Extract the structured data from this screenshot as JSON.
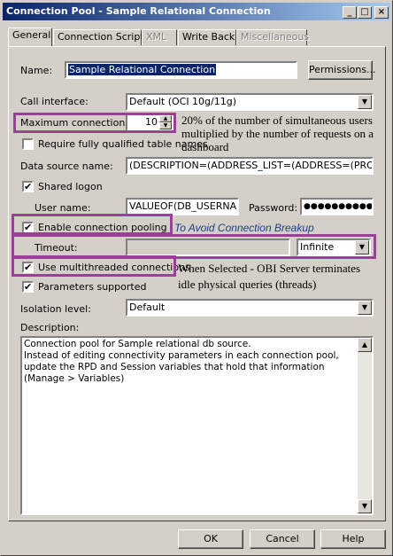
{
  "window": {
    "title": "Connection Pool - Sample Relational Connection",
    "minimize": "_",
    "maximize": "□",
    "close": "×"
  },
  "tabs": [
    {
      "label": "General",
      "active": true
    },
    {
      "label": "Connection Scripts"
    },
    {
      "label": "XML",
      "disabled": true
    },
    {
      "label": "Write Back"
    },
    {
      "label": "Miscellaneous",
      "disabled": true
    }
  ],
  "form": {
    "name_label": "Name:",
    "name_value": "Sample Relational Connection",
    "permissions_button": "Permissions...",
    "call_interface_label": "Call interface:",
    "call_interface_value": "Default (OCI 10g/11g)",
    "max_connections_label": "Maximum connections:",
    "max_connections_value": "10",
    "require_qualified_label": "Require fully qualified table names",
    "require_qualified_checked": false,
    "data_source_label": "Data source name:",
    "data_source_value": "(DESCRIPTION=(ADDRESS_LIST=(ADDRESS=(PROTO",
    "shared_logon_label": "Shared logon",
    "shared_logon_checked": true,
    "user_name_label": "User name:",
    "user_name_value": "VALUEOF(DB_USERNAI",
    "password_label": "Password:",
    "password_value": "●●●●●●●●●●",
    "enable_pooling_label": "Enable connection pooling",
    "enable_pooling_checked": true,
    "timeout_label": "Timeout:",
    "timeout_value": "",
    "timeout_unit": "Infinite",
    "multithreaded_label": "Use multithreaded connections",
    "multithreaded_checked": true,
    "params_supported_label": "Parameters supported",
    "params_supported_checked": true,
    "isolation_label": "Isolation level:",
    "isolation_value": "Default",
    "description_label": "Description:",
    "description_line1": "Connection pool for Sample relational db source.",
    "description_line2": "Instead of editing connectivity parameters in each connection pool, update the RPD and Session variables that hold that information (Manage > Variables)"
  },
  "annotations": {
    "max_connections_note_1": "20% of the number of simultaneous users",
    "max_connections_note_2": "multiplied by the number of requests on a",
    "max_connections_note_3": "dashboard",
    "pooling_note": "To Avoid Connection Breakup",
    "multithreaded_note_1": "When Selected - OBI Server terminates",
    "multithreaded_note_2": "idle physical queries (threads)"
  },
  "buttons": {
    "ok": "OK",
    "cancel": "Cancel",
    "help": "Help"
  },
  "icons": {
    "check": "✔",
    "dropdown": "▼",
    "up": "▲",
    "down": "▼"
  },
  "colors": {
    "highlight": "#9b3f9b",
    "title_bar": "#0a246a",
    "annotation_blue": "#1f3d8c"
  }
}
